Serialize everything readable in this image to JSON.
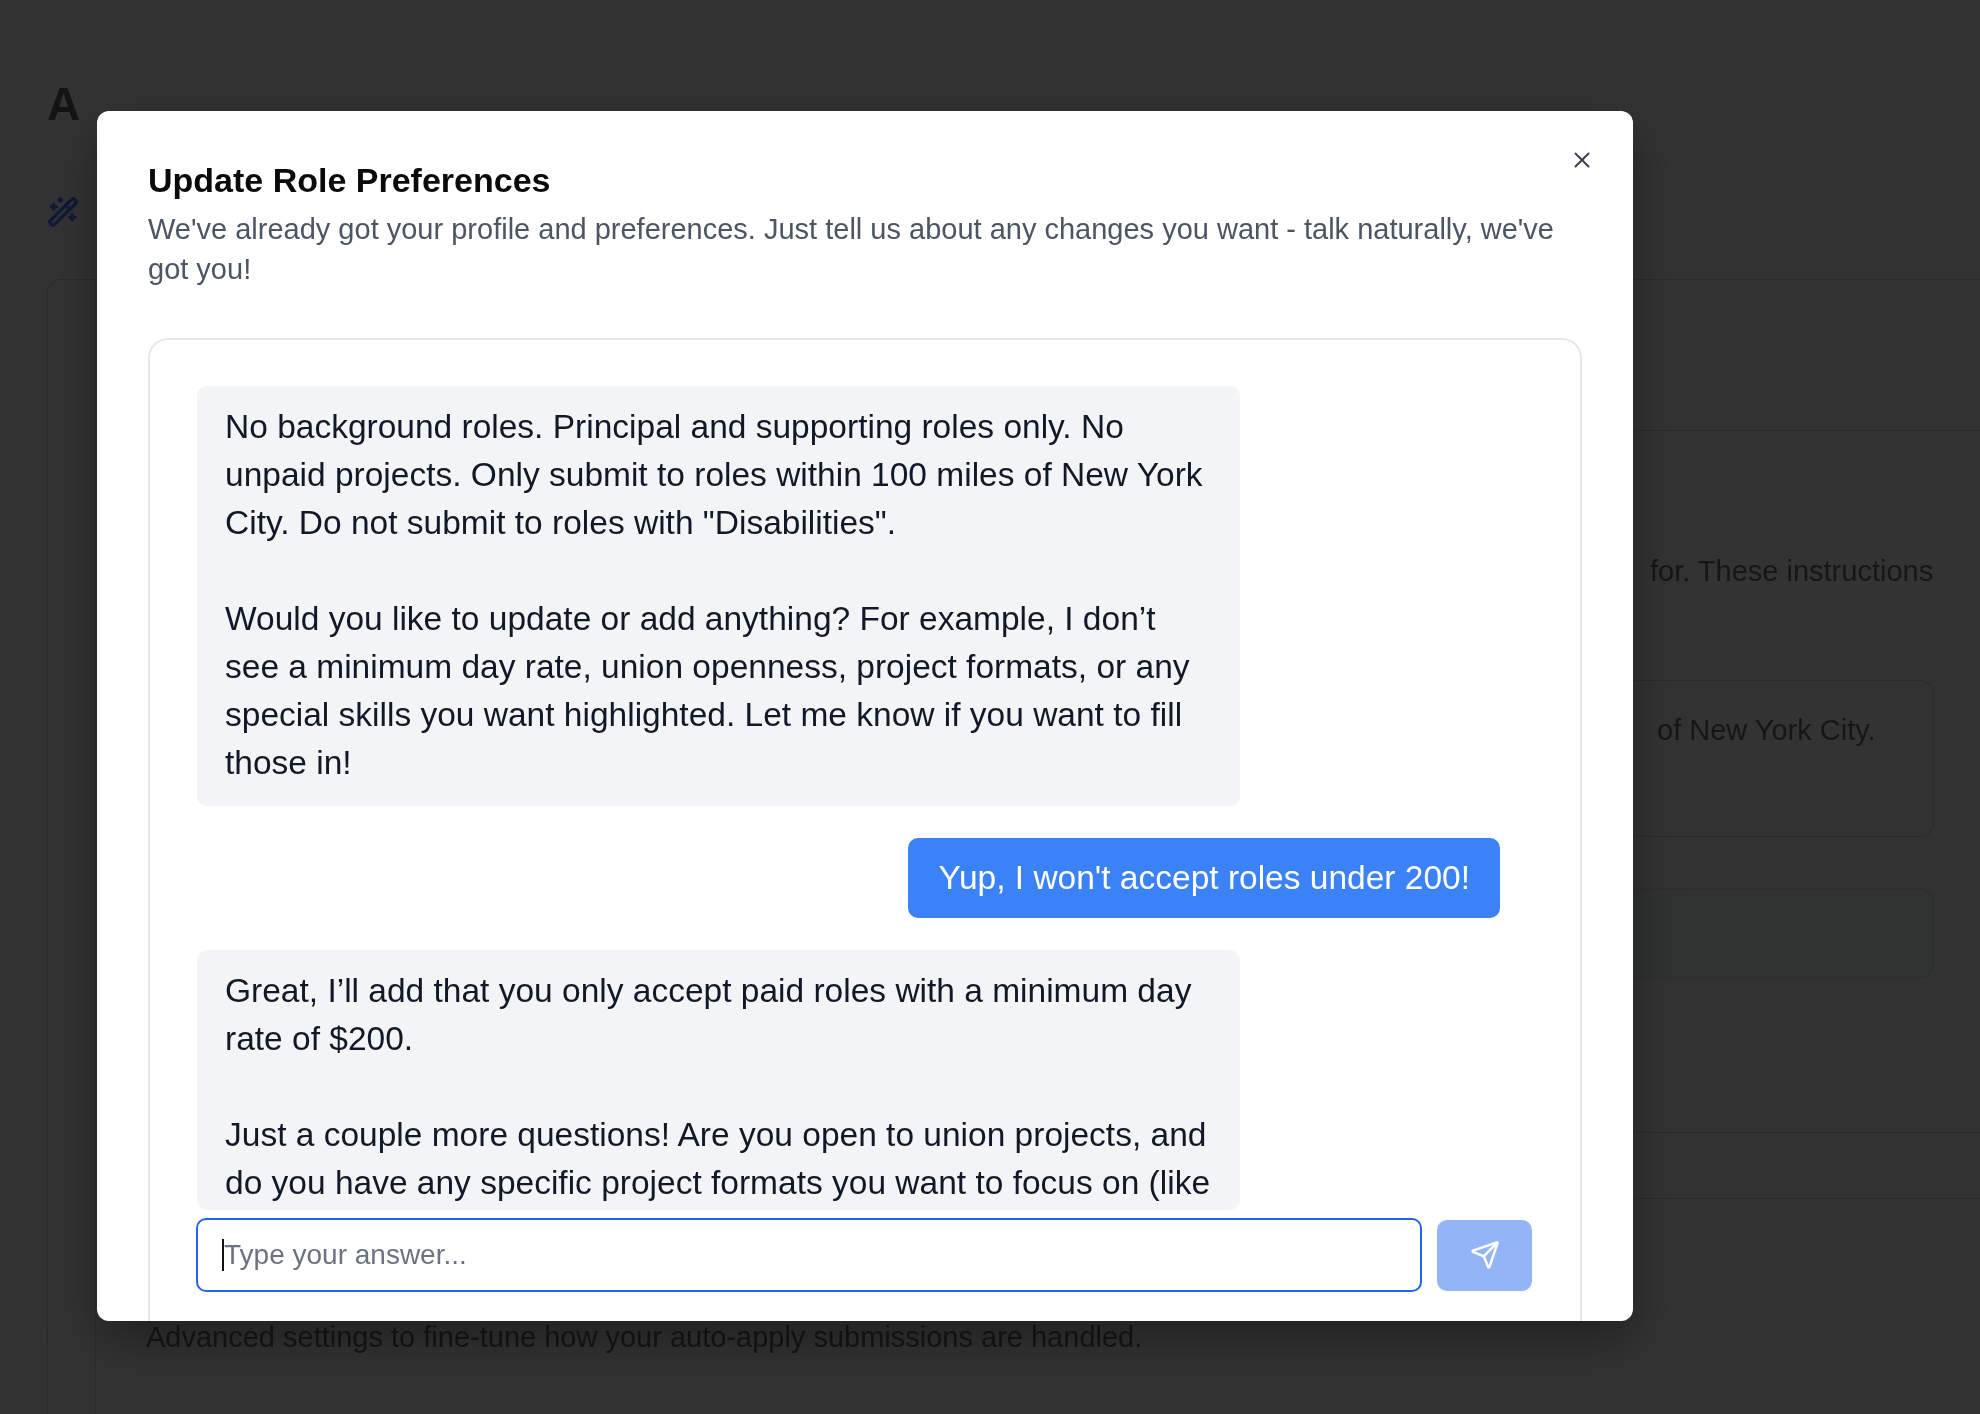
{
  "background_page": {
    "heading": "A",
    "instructions_fragment": "for. These instructions",
    "card_fragment": "of New York City.",
    "section_description": "Advanced settings to fine-tune how your auto-apply submissions are handled."
  },
  "dialog": {
    "title": "Update Role Preferences",
    "description": "We've already got your profile and preferences. Just tell us about any changes you want - talk naturally, we've got you!",
    "messages": [
      {
        "kind": "assistant",
        "paragraphs": [
          "No background roles. Principal and supporting roles only. No unpaid projects. Only submit to roles within 100 miles of New York City. Do not submit to roles with \"Disabilities\".",
          "Would you like to update or add anything? For example, I don’t see a minimum day rate, union openness, project formats, or any special skills you want highlighted. Let me know if you want to fill those in!"
        ]
      },
      {
        "kind": "user",
        "paragraphs": [
          "Yup, I won't accept roles under 200!"
        ]
      },
      {
        "kind": "assistant",
        "paragraphs": [
          "Great, I’ll add that you only accept paid roles with a minimum day rate of $200.",
          "Just a couple more questions! Are you open to union projects, and do you have any specific project formats you want to focus on (like"
        ]
      }
    ],
    "input": {
      "placeholder": "Type your answer...",
      "focused": true
    },
    "send_button": {
      "disabled": true
    }
  }
}
